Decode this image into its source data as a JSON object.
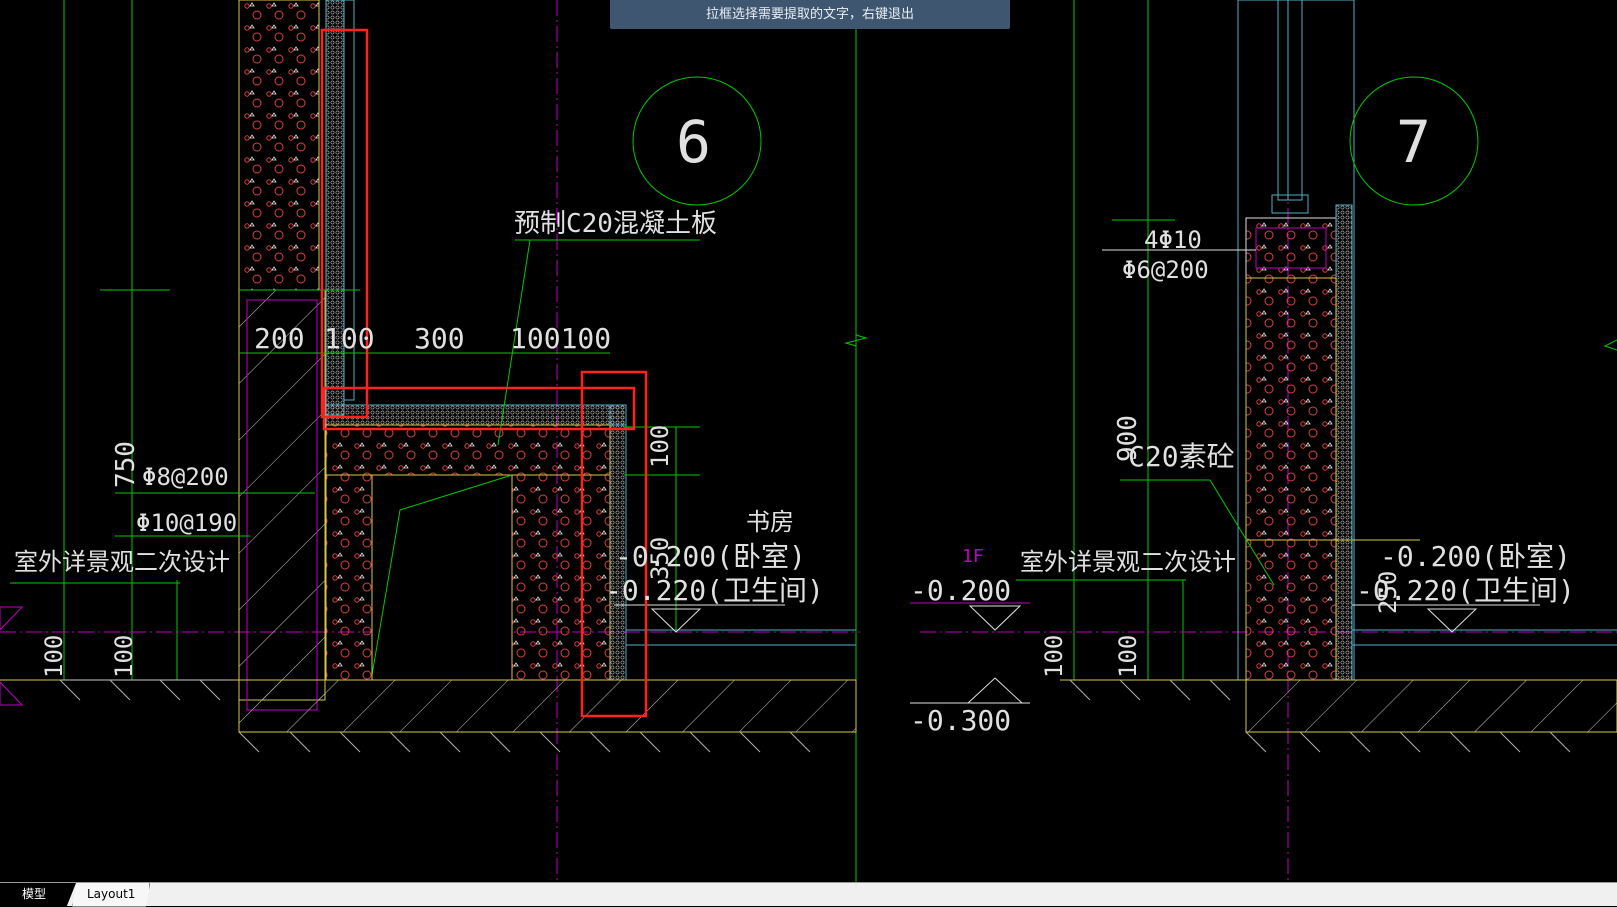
{
  "tooltip": "拉框选择需要提取的文字，右键退出",
  "tabs": [
    {
      "label": "模型"
    },
    {
      "label": "Layout1"
    }
  ],
  "drawing": {
    "detail_6": "6",
    "detail_7": "7",
    "precast_label": "预制C20混凝土板",
    "dims": {
      "d200": "200",
      "d100a": "100",
      "d300": "300",
      "d100b": "100100",
      "d750": "750",
      "d100_v": "100",
      "d350": "350",
      "d900": "900",
      "d250": "250",
      "d100_l1": "100",
      "d100_l2": "100",
      "d100_r1": "100",
      "d100_r2": "100"
    },
    "rebar1": "Φ8@200",
    "rebar2": "Φ10@190",
    "rebar3": "4Φ10",
    "rebar4": "Φ6@200",
    "outdoor_left": "室外详景观二次设计",
    "outdoor_right": "室外详景观二次设计",
    "study": "书房",
    "level_bed_left": "-0.200(卧室)",
    "level_bath_left": "-0.220(卫生间)",
    "level_bed_right": "-0.200(卧室)",
    "level_bath_right": "-0.220(卫生间)",
    "floor_tag": "1F",
    "level_m200": "-0.200",
    "level_m300": "-0.300",
    "c20_plain": "C20素砼"
  },
  "colors": {
    "background": "#000000",
    "green": "#00c800",
    "white": "#e0e0e0",
    "yellow": "#d6c84a",
    "magenta": "#c000c0",
    "cyan": "#4fb0c8",
    "red": "#ff2020",
    "tooltip_bg": "#3f5670"
  }
}
